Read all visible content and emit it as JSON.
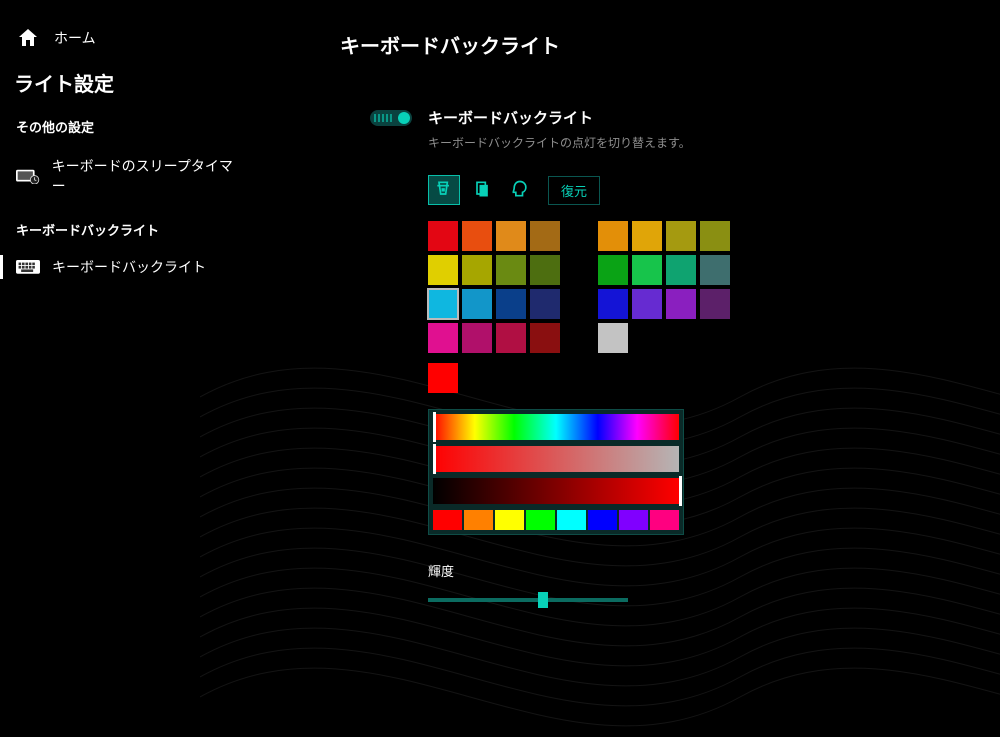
{
  "sidebar": {
    "home_label": "ホーム",
    "section_title": "ライト設定",
    "other_settings_label": "その他の設定",
    "sleep_timer_label": "キーボードのスリープタイマー",
    "backlight_heading": "キーボードバックライト",
    "backlight_item_label": "キーボードバックライト"
  },
  "main": {
    "title": "キーボードバックライト",
    "toggle_label": "キーボードバックライト",
    "toggle_description": "キーボードバックライトの点灯を切り替えます。",
    "toggle_state": true,
    "mode_icons": [
      "fill-bucket",
      "cards",
      "profile"
    ],
    "mode_selected_index": 0,
    "restore_label": "復元",
    "palette": {
      "rows": [
        [
          "#e30613",
          "#e84e0f",
          "#e08a1a",
          "#a36a15",
          null,
          "#e38f08",
          "#e0a508",
          "#a59a10",
          "#8a8f12"
        ],
        [
          "#e0cf00",
          "#a6a600",
          "#6a8a12",
          "#4d6e10",
          null,
          "#0aa315",
          "#17c44b",
          "#0fa370",
          "#3e6e6e"
        ],
        [
          "#0fb7e0",
          "#1296c9",
          "#0a3f8a",
          "#1f2a6e",
          null,
          "#1414d6",
          "#662bd1",
          "#8a1fbf",
          "#5c2069"
        ],
        [
          "#e01090",
          "#b0106a",
          "#b00f43",
          "#8a0f10",
          null,
          "#c3c3c3",
          "",
          "",
          ""
        ]
      ],
      "selected_rc": [
        2,
        0
      ]
    },
    "current_color": "#ff0000",
    "picker": {
      "hue_handle_pct": 0,
      "sat_handle_pct": 0,
      "val_handle_pct": 100,
      "presets": [
        "#ff0000",
        "#ff8000",
        "#ffff00",
        "#00ff00",
        "#00ffff",
        "#0000ff",
        "#8000ff",
        "#ff0080"
      ]
    },
    "brightness": {
      "label": "輝度",
      "value_pct": 55
    }
  }
}
